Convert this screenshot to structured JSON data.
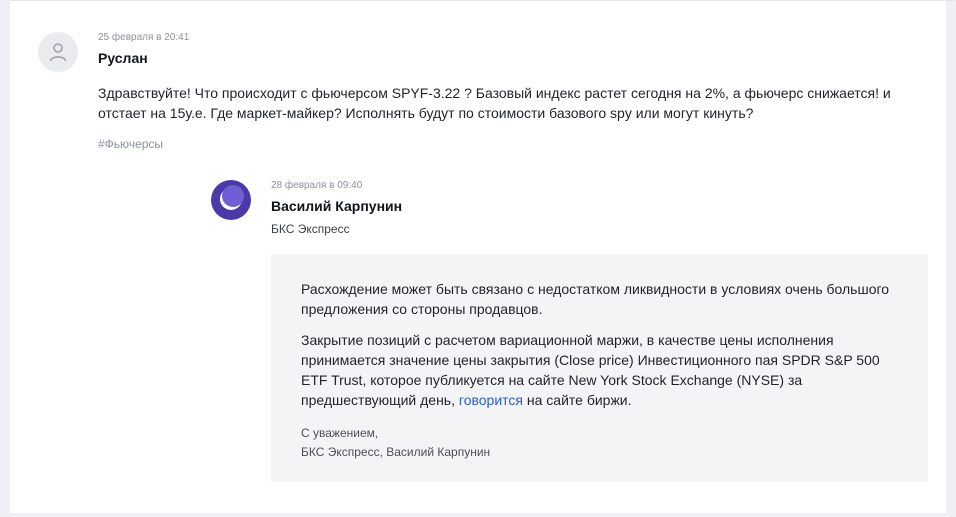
{
  "question": {
    "date": "25 февраля в 20:41",
    "author": "Руслан",
    "text": "Здравствуйте! Что происходит с фьючерсом SPYF-3.22 ? Базовый индекс растет сегодня на 2%, а фьючерс снижается! и отстает на 15у.е. Где маркет-майкер? Исполнять будут по стоимости базового spy или могут кинуть?",
    "tag": "#Фьючерсы"
  },
  "answer": {
    "date": "28 февраля в 09:40",
    "author": "Василий Карпунин",
    "company": "БКС Экспресс",
    "paragraph1": "Расхождение может быть связано с недостатком ликвидности в условиях очень большого предложения со стороны продавцов.",
    "paragraph2_before_link": "Закрытие позиций с расчетом вариационной маржи, в качестве цены исполнения принимается значение цены закрытия (Close price) Инвестиционного пая SPDR S&P 500 ETF Trust, которое публикуется на сайте New York Stock Exchange (NYSE) за предшествующий день, ",
    "paragraph2_link": "говорится",
    "paragraph2_after_link": " на сайте биржи.",
    "signature_line1": "С уважением,",
    "signature_line2": "БКС Экспресс, Василий Карпунин"
  },
  "colors": {
    "link": "#2c5bd3",
    "bks_avatar": "#4a3aa8",
    "answer_background": "#f3f4f6"
  },
  "icons": {
    "user_avatar": "user-silhouette-icon",
    "bks_avatar": "bks-logo-icon"
  }
}
